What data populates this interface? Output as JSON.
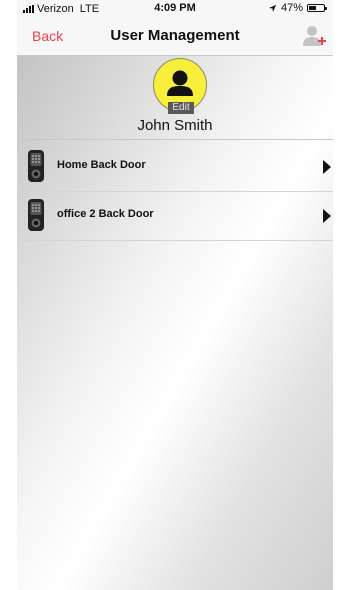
{
  "status_bar": {
    "carrier": "Verizon",
    "network": "LTE",
    "time": "4:09 PM",
    "battery": "47%",
    "battery_level": 0.47
  },
  "nav": {
    "back_label": "Back",
    "title": "User Management",
    "add_user_icon": "add-user-icon"
  },
  "profile": {
    "edit_label": "Edit",
    "name": "John Smith",
    "avatar_color": "#f7ef3a"
  },
  "locks": [
    {
      "name": "Home Back Door"
    },
    {
      "name": "office 2 Back Door"
    }
  ],
  "colors": {
    "accent": "#e8434a"
  }
}
